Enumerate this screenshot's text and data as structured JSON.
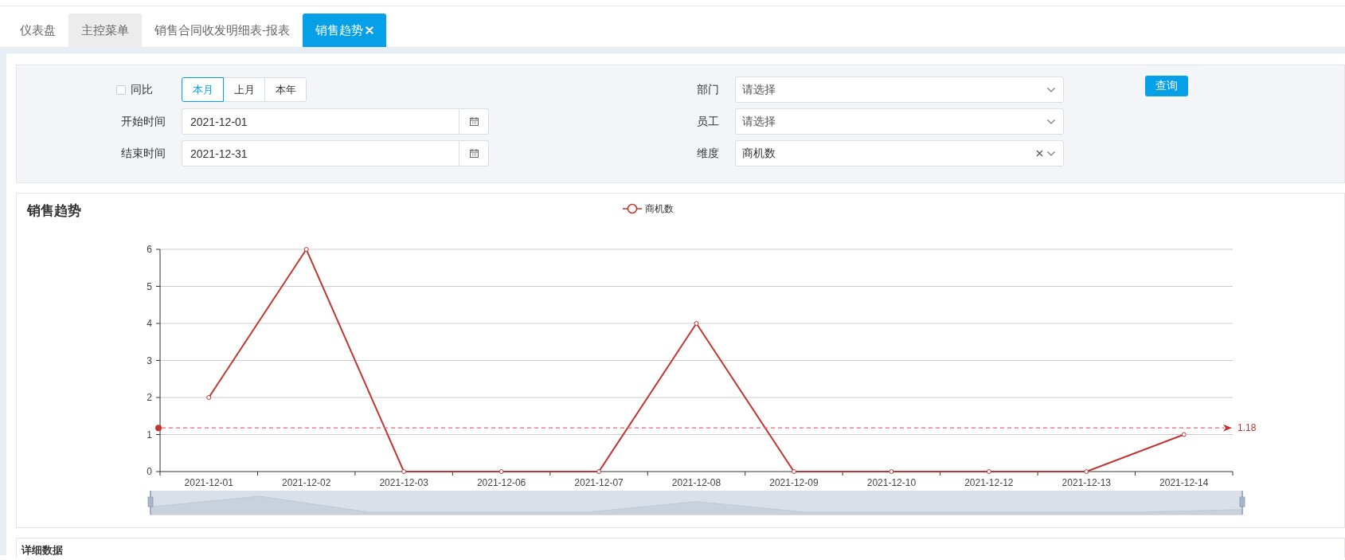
{
  "tabs": [
    {
      "label": "仪表盘",
      "kind": "page",
      "selected": false,
      "closable": false
    },
    {
      "label": "主控菜单",
      "kind": "home",
      "selected": false,
      "closable": false
    },
    {
      "label": "销售合同收发明细表-报表",
      "kind": "page",
      "selected": false,
      "closable": false
    },
    {
      "label": "销售趋势",
      "kind": "page",
      "selected": true,
      "closable": true
    }
  ],
  "filters": {
    "yoy": {
      "label": "同比",
      "checked": false
    },
    "periods": [
      {
        "label": "本月",
        "selected": true
      },
      {
        "label": "上月",
        "selected": false
      },
      {
        "label": "本年",
        "selected": false
      }
    ],
    "start": {
      "label": "开始时间",
      "value": "2021-12-01"
    },
    "end": {
      "label": "结束时间",
      "value": "2021-12-31"
    },
    "department": {
      "label": "部门",
      "placeholder": "请选择",
      "clearable": false
    },
    "employee": {
      "label": "员工",
      "placeholder": "请选择",
      "clearable": false
    },
    "dimension": {
      "label": "维度",
      "value": "商机数",
      "clearable": true
    },
    "query_button": "查询"
  },
  "chart": {
    "title": "销售趋势",
    "chart_data": {
      "type": "line",
      "categories": [
        "2021-12-01",
        "2021-12-02",
        "2021-12-03",
        "2021-12-06",
        "2021-12-07",
        "2021-12-08",
        "2021-12-09",
        "2021-12-10",
        "2021-12-12",
        "2021-12-13",
        "2021-12-14"
      ],
      "series": [
        {
          "name": "商机数",
          "color": "#c23531",
          "marker": "circle",
          "values": [
            2,
            6,
            0,
            0,
            0,
            4,
            0,
            0,
            0,
            0,
            1
          ]
        }
      ],
      "ylim": [
        0,
        6
      ],
      "yticks": [
        0,
        1,
        2,
        3,
        4,
        5,
        6
      ],
      "grid": true,
      "ref_lines": [
        {
          "axis": "y",
          "value": 1.18,
          "label": "1.18"
        }
      ]
    }
  },
  "detail": {
    "title": "详细数据"
  }
}
